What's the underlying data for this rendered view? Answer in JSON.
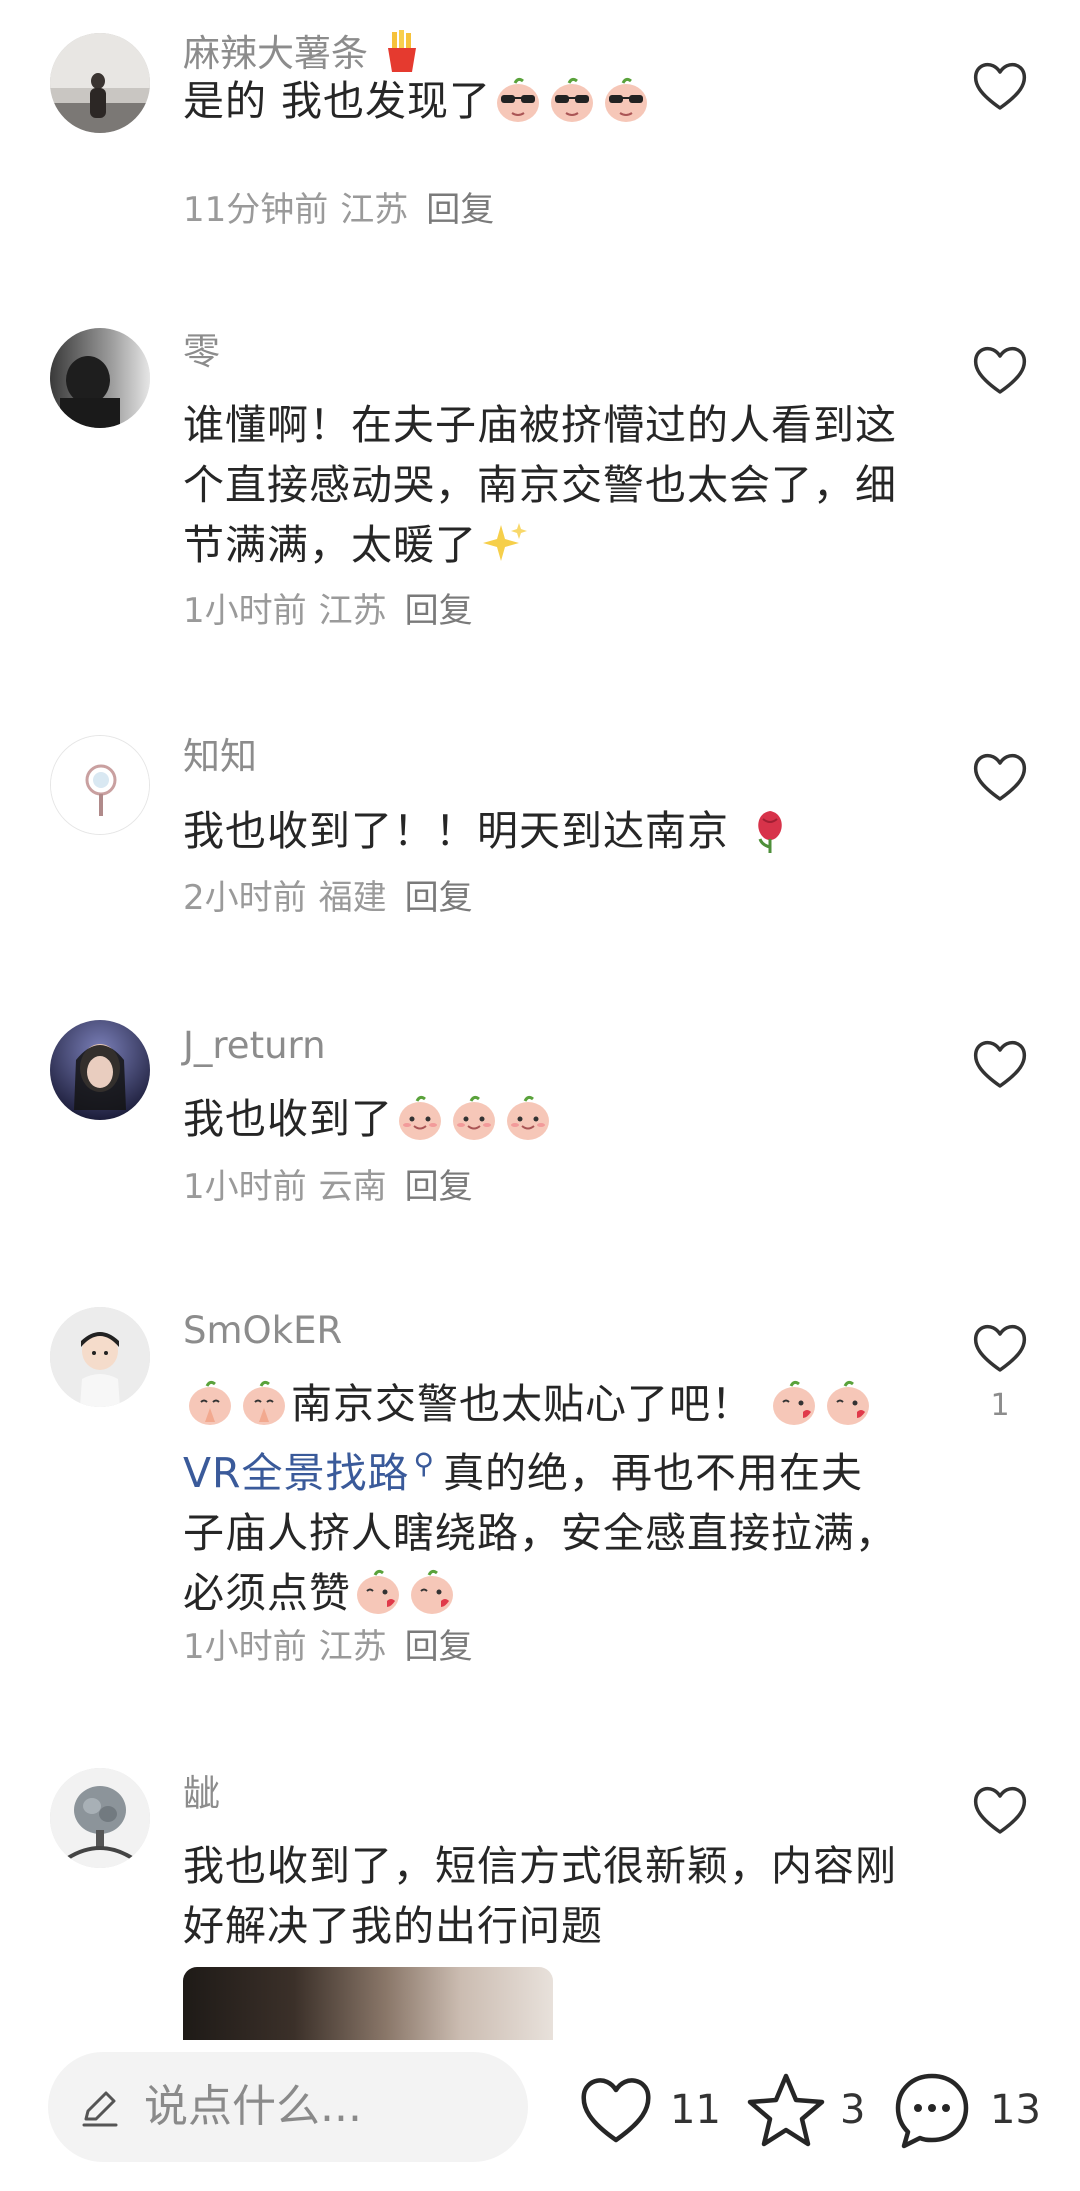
{
  "comments": [
    {
      "username": "麻辣大薯条",
      "username_emoji": "fries",
      "text": "是的 我也发现了",
      "text_emojis": [
        "sunglasses-peach",
        "sunglasses-peach",
        "sunglasses-peach"
      ],
      "time": "11分钟前",
      "location": "江苏",
      "reply": "回复"
    },
    {
      "username": "零",
      "text": "谁懂啊！在夫子庙被挤懵过的人看到这个直接感动哭，南京交警也太会了，细节满满，太暖了",
      "text_emojis": [
        "sparkles"
      ],
      "time": "1小时前",
      "location": "江苏",
      "reply": "回复"
    },
    {
      "username": "知知",
      "text": "我也收到了！！明天到达南京",
      "text_emojis": [
        "rose"
      ],
      "time": "2小时前",
      "location": "福建",
      "reply": "回复"
    },
    {
      "username": "J_return",
      "text": "我也收到了",
      "text_emojis": [
        "smile-peach",
        "smile-peach",
        "smile-peach"
      ],
      "time": "1小时前",
      "location": "云南",
      "reply": "回复"
    },
    {
      "username": "SmOkER",
      "text_part1": "南京交警也太贴心了吧！",
      "link_text": "VR全景找路",
      "text_part2": "真的绝，再也不用在夫子庙人挤人瞎绕路，安全感直接拉满，必须点赞",
      "lead_emojis": [
        "pray-peach",
        "pray-peach"
      ],
      "mid_emojis": [
        "kiss-peach",
        "kiss-peach"
      ],
      "tail_emojis": [
        "kiss-peach",
        "kiss-peach"
      ],
      "like_count": "1",
      "time": "1小时前",
      "location": "江苏",
      "reply": "回复"
    },
    {
      "username": "龇",
      "text": "我也收到了，短信方式很新颖，内容刚好解决了我的出行问题",
      "has_media": true
    }
  ],
  "bottom_bar": {
    "placeholder": "说点什么...",
    "like_count": "11",
    "star_count": "3",
    "comment_count": "13"
  },
  "icons": {
    "like": "heart-outline-icon",
    "star": "star-outline-icon",
    "comment": "speech-bubble-icon",
    "edit": "pencil-icon"
  }
}
